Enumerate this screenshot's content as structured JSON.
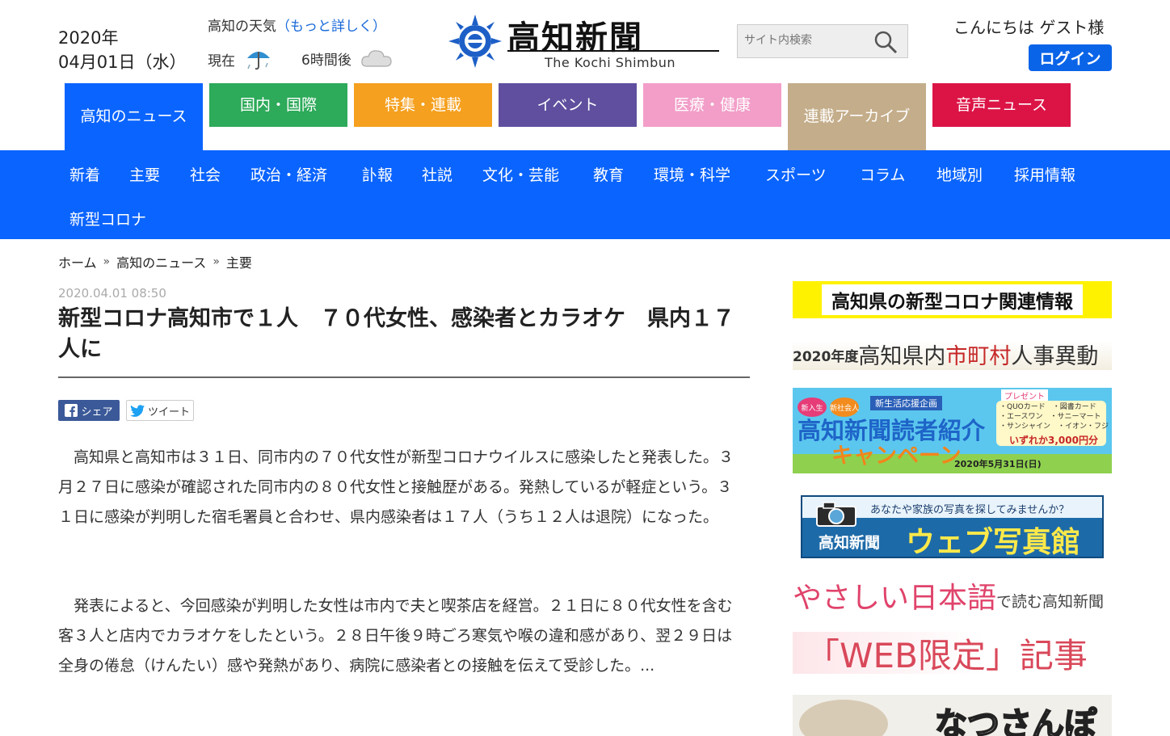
{
  "header": {
    "date_line1": "2020年",
    "date_line2": "04月01日（水）",
    "weather_title": "高知の天気",
    "weather_more": "（もっと詳しく）",
    "weather_now_label": "現在",
    "weather_later_label": "6時間後",
    "logo_text": "高知新聞",
    "logo_sub": "The Kochi Shimbun",
    "search_placeholder": "サイト内検索",
    "greeting": "こんにちは ゲスト様",
    "login_label": "ログイン"
  },
  "category_tabs": [
    {
      "label": "高知のニュース",
      "color": "#0a64ff"
    },
    {
      "label": "国内・国際",
      "color": "#2daa5a"
    },
    {
      "label": "特集・連載",
      "color": "#f5a01e"
    },
    {
      "label": "イベント",
      "color": "#5f4f9e"
    },
    {
      "label": "医療・健康",
      "color": "#f29ec8"
    },
    {
      "label": "連載アーカイブ",
      "color": "#c4ad8a"
    },
    {
      "label": "音声ニュース",
      "color": "#dc1446"
    }
  ],
  "subnav": [
    "新着",
    "主要",
    "社会",
    "政治・経済",
    "訃報",
    "社説",
    "文化・芸能",
    "教育",
    "環境・科学",
    "スポーツ",
    "コラム",
    "地域別",
    "採用情報",
    "新型コロナ"
  ],
  "breadcrumb": [
    "ホーム",
    "高知のニュース",
    "主要"
  ],
  "breadcrumb_sep": "»",
  "article": {
    "timestamp": "2020.04.01 08:50",
    "title": "新型コロナ高知市で１人　７０代女性、感染者とカラオケ　県内１７人に",
    "share_facebook": "シェア",
    "share_twitter": "ツイート",
    "paragraph1": "高知県と高知市は３１日、同市内の７０代女性が新型コロナウイルスに感染したと発表した。３月２７日に感染が確認された同市内の８０代女性と接触歴がある。発熱しているが軽症という。３１日に感染が判明した宿毛署員と合わせ、県内感染者は１７人（うち１２人は退院）になった。",
    "paragraph2": "発表によると、今回感染が判明した女性は市内で夫と喫茶店を経営。２１日に８０代女性を含む客３人と店内でカラオケをしたという。２８日午後９時ごろ寒気や喉の違和感があり、翌２９日は全身の倦怠（けんたい）感や発熱があり、病院に感染者との接触を伝えて受診した。..."
  },
  "sidebar": {
    "banner1": "高知県の新型コロナ関連情報",
    "banner2_year": "2020年度",
    "banner2_a": "高知県内",
    "banner2_b": "市町村",
    "banner2_c": "人事異動",
    "banner3_top": "新生活応援企画",
    "banner3_tag1": "新入生",
    "banner3_tag2": "新社会人",
    "banner3_present": "プレゼント",
    "banner3_gifts": "・QUOカード　・図書カード\n・エースワン　・サニーマート\n・サンシャイン　・イオン・フジ",
    "banner3_amount": "いずれか3,000円分",
    "banner3_main1": "高知新聞読者紹介",
    "banner3_main2": "キャンペーン",
    "banner3_deadline": "2020年5月31日(日)",
    "banner4_top": "あなたや家族の写真を探してみませんか？",
    "banner4_brand": "高知新聞",
    "banner4_main": "ウェブ写真館",
    "banner5_main": "やさしい日本語",
    "banner5_sub": "で読む高知新聞",
    "banner6": "「WEB限定」記事",
    "banner7": "なつさんぽ"
  }
}
